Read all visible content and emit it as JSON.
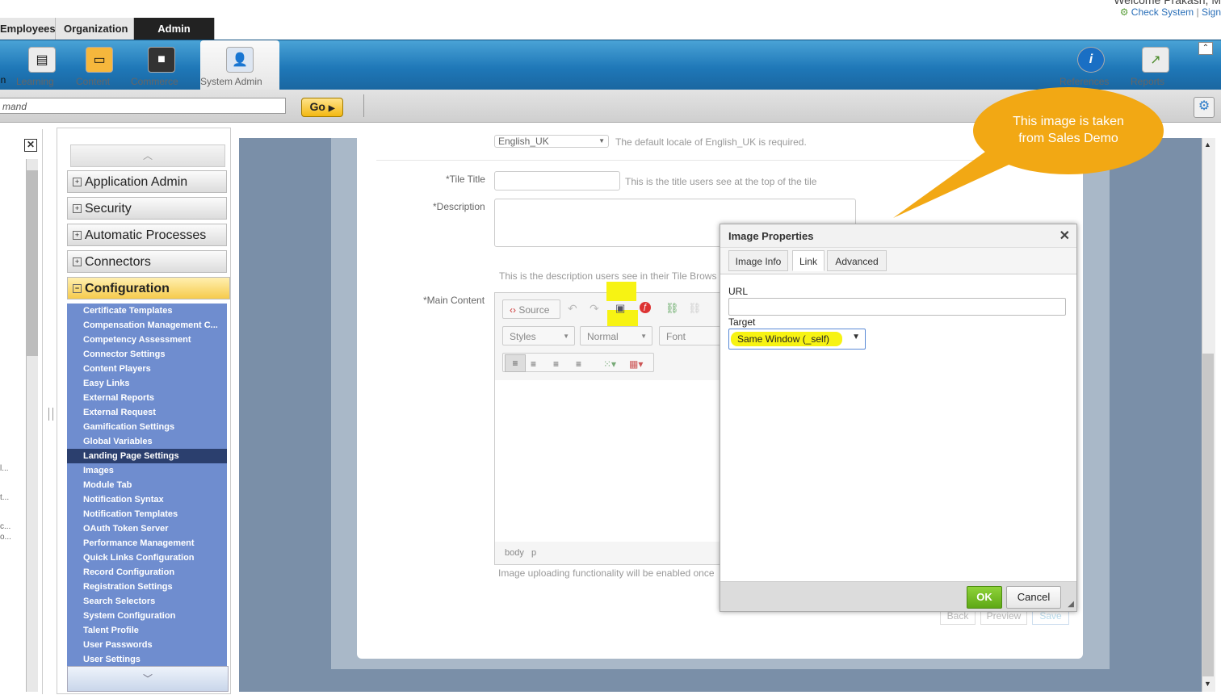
{
  "header": {
    "welcome": "Welcome Prakash, M",
    "check_system": "Check System",
    "sign_out": "Sign",
    "separator": "|"
  },
  "top_tabs": [
    "Employees",
    "Organization",
    "Admin"
  ],
  "nav_buttons": {
    "partial_left": "n",
    "learning": "Learning",
    "content": "Content",
    "commerce": "Commerce",
    "system_admin": "System Admin",
    "references": "References",
    "reports": "Reports"
  },
  "command": {
    "placeholder": "mand",
    "go_label": "Go"
  },
  "config_nav": {
    "sections": [
      "Application Admin",
      "Security",
      "Automatic Processes",
      "Connectors",
      "Configuration"
    ],
    "items": [
      "Certificate Templates",
      "Compensation Management C...",
      "Competency Assessment",
      "Connector Settings",
      "Content Players",
      "Easy Links",
      "External Reports",
      "External Request",
      "Gamification Settings",
      "Global Variables",
      "Landing Page Settings",
      "Images",
      "Module Tab",
      "Notification Syntax",
      "Notification Templates",
      "OAuth Token Server",
      "Performance Management",
      "Quick Links Configuration",
      "Record Configuration",
      "Registration Settings",
      "Search Selectors",
      "System Configuration",
      "Talent Profile",
      "User Passwords",
      "User Settings"
    ],
    "selected": "Landing Page Settings"
  },
  "left_panel_fragments": [
    "o...",
    "l...",
    "t...",
    "c..."
  ],
  "form": {
    "locale_value": "English_UK",
    "locale_hint": "The default locale of English_UK is required.",
    "tile_title_label": "*Tile Title",
    "tile_title_hint": "This is the title users see at the top of the tile",
    "description_label": "*Description",
    "description_hint": "This is the description users see in their Tile Brows",
    "main_content_label": "*Main Content",
    "upload_hint": "Image uploading functionality will be enabled once",
    "back": "Back",
    "preview": "Preview",
    "save": "Save"
  },
  "editor": {
    "source_label": "Source",
    "styles": "Styles",
    "format": "Normal",
    "font": "Font",
    "path": [
      "body",
      "p"
    ]
  },
  "dialog": {
    "title": "Image Properties",
    "tabs": [
      "Image Info",
      "Link",
      "Advanced"
    ],
    "active_tab": "Link",
    "url_label": "URL",
    "url_value": "",
    "target_label": "Target",
    "target_value": "Same Window (_self)",
    "ok": "OK",
    "cancel": "Cancel"
  },
  "callout": {
    "text_line1": "This image is taken",
    "text_line2": "from Sales Demo",
    "color": "#f2a814"
  },
  "colors": {
    "highlight": "#f7f313",
    "nav_blue": "#6f8dcf",
    "toolbar_blue": "#1f78b8"
  }
}
